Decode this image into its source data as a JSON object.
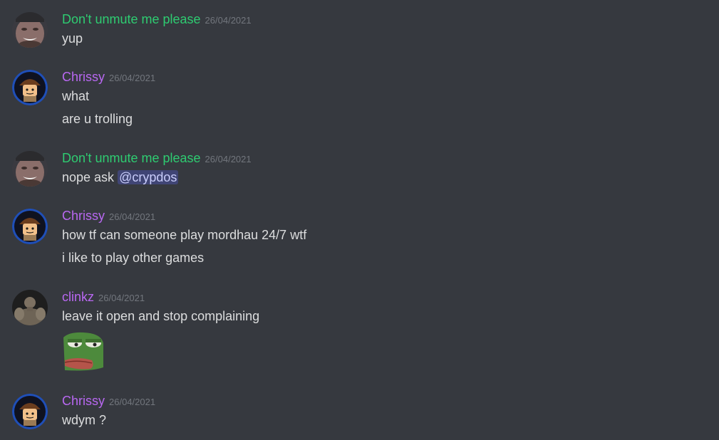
{
  "colors": {
    "background": "#36393f",
    "green_user": "#2ecc71",
    "purple_user": "#b968f2",
    "timestamp": "#72767d",
    "text": "#dcddde",
    "mention_bg": "#414675",
    "mention_text": "#c9cdfb"
  },
  "messages": [
    {
      "username": "Don't unmute me please",
      "timestamp": "26/04/2021",
      "avatar": "face-avatar",
      "lines": [
        "yup"
      ]
    },
    {
      "username": "Chrissy",
      "timestamp": "26/04/2021",
      "avatar": "lego-avatar",
      "lines": [
        "what",
        "are u trolling"
      ]
    },
    {
      "username": "Don't unmute me please",
      "timestamp": "26/04/2021",
      "avatar": "face-avatar",
      "line_prefix": "nope ask ",
      "mention": "@crypdos"
    },
    {
      "username": "Chrissy",
      "timestamp": "26/04/2021",
      "avatar": "lego-avatar",
      "lines": [
        "how tf can someone play mordhau 24/7 wtf",
        "i like to play other games"
      ]
    },
    {
      "username": "clinkz",
      "timestamp": "26/04/2021",
      "avatar": "muscle-avatar",
      "lines": [
        "leave it open and stop complaining"
      ],
      "emoji": "pepe-emoji"
    },
    {
      "username": "Chrissy",
      "timestamp": "26/04/2021",
      "avatar": "lego-avatar",
      "lines": [
        "wdym ?"
      ]
    }
  ]
}
